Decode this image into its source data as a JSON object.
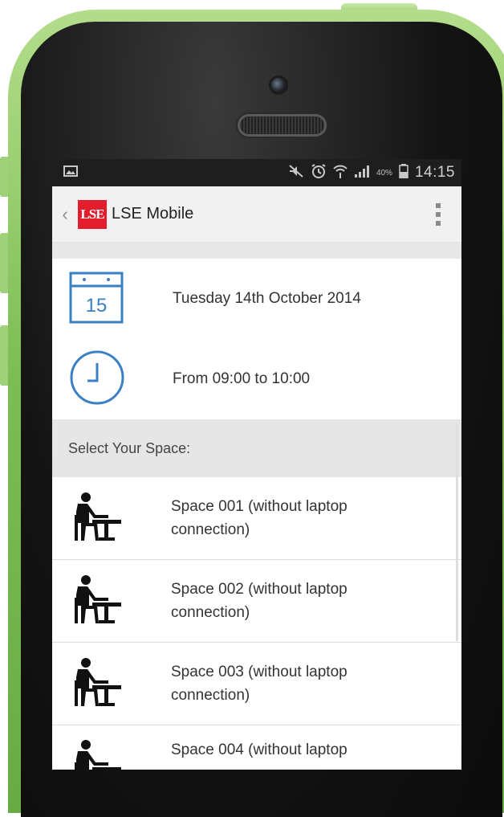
{
  "status_bar": {
    "battery_percent": "40%",
    "time": "14:15",
    "icons": [
      "image-icon",
      "mute-icon",
      "alarm-icon",
      "wifi-icon",
      "signal-icon",
      "battery-icon"
    ]
  },
  "app_bar": {
    "title": "LSE Mobile",
    "logo_text": "LSE"
  },
  "booking": {
    "calendar_day": "15",
    "date": "Tuesday 14th October 2014",
    "time_range": "From 09:00 to 10:00"
  },
  "spaces_section": {
    "header": "Select Your Space:",
    "items": [
      {
        "label": "Space 001 (without laptop connection)"
      },
      {
        "label": "Space 002 (without laptop connection)"
      },
      {
        "label": "Space 003 (without laptop connection)"
      },
      {
        "label": "Space 004 (without laptop"
      }
    ]
  },
  "colors": {
    "phone_shell": "#7dbd55",
    "lse_red": "#e31d2b",
    "icon_blue": "#3b7fc4"
  }
}
